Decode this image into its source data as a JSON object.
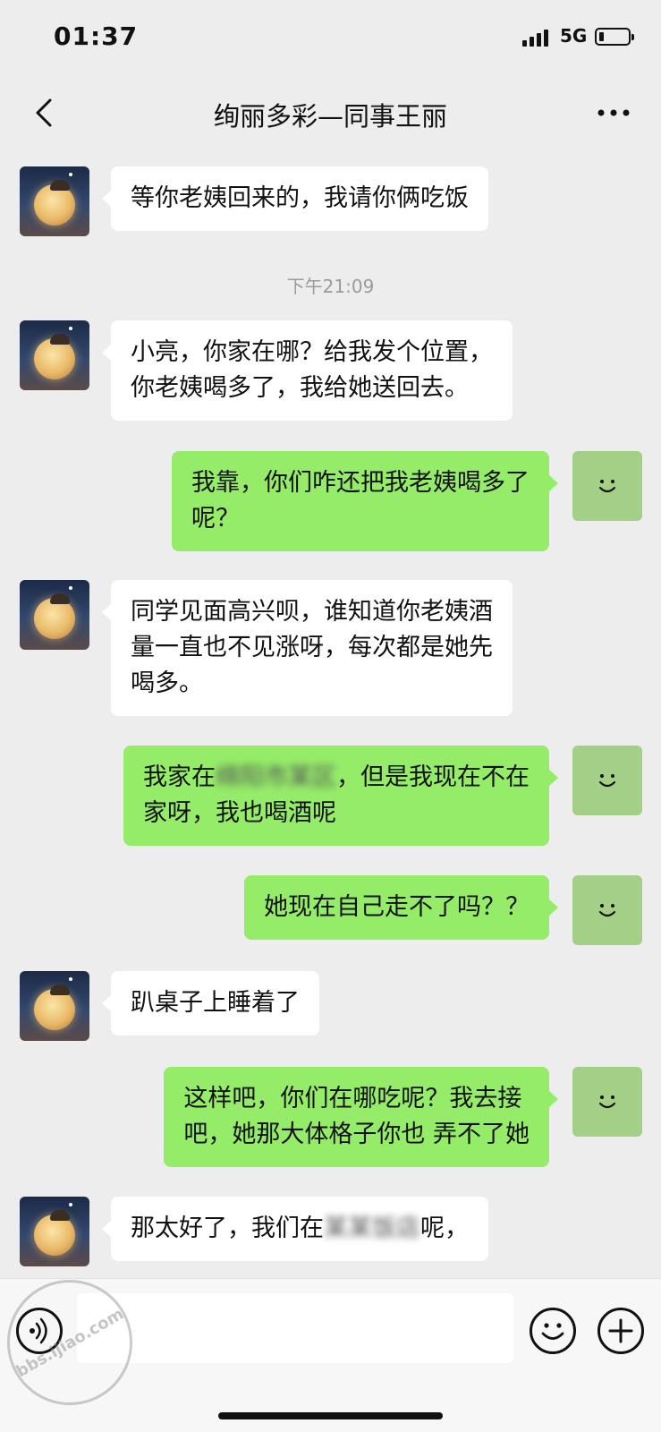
{
  "status_bar": {
    "time": "01:37",
    "network": "5G",
    "battery_level": 0.15
  },
  "header": {
    "back_icon": "chevron-left-icon",
    "title": "绚丽多彩—同事王丽",
    "more_icon": "more-dots-icon"
  },
  "timestamp": "下午21:09",
  "messages": [
    {
      "side": "in",
      "lines": [
        "等你老姨回来的，我请你俩吃饭"
      ]
    },
    {
      "side": "in",
      "lines": [
        "小亮，你家在哪？给我发个位置，",
        "你老姨喝多了，我给她送回去。"
      ]
    },
    {
      "side": "out",
      "lines": [
        "我靠，你们咋还把我老姨喝多了",
        "呢？"
      ]
    },
    {
      "side": "in",
      "lines": [
        "同学见面高兴呗，谁知道你老姨酒",
        "量一直也不见涨呀，每次都是她先",
        "喝多。"
      ]
    },
    {
      "side": "out",
      "line1_before": "我家在",
      "line1_redacted": "绵阳市某区",
      "line1_after": "，但是我现在不在",
      "line2": "家呀，我也喝酒呢"
    },
    {
      "side": "out",
      "lines": [
        "她现在自己走不了吗？？"
      ]
    },
    {
      "side": "in",
      "lines": [
        "趴桌子上睡着了"
      ]
    },
    {
      "side": "out",
      "lines": [
        "这样吧，你们在哪吃呢？我去接",
        "吧，她那大体格子你也 弄不了她"
      ]
    },
    {
      "side": "in",
      "line1_before": "那太好了，我们在",
      "line1_redacted": "某某饭店",
      "line1_after": "呢，"
    }
  ],
  "input_bar": {
    "voice_icon": "voice-icon",
    "input_value": "",
    "emoji_icon": "emoji-icon",
    "plus_icon": "plus-icon"
  },
  "watermark": {
    "text": "bbs.ijiao.com"
  },
  "colors": {
    "background": "#ededed",
    "bubble_in": "#ffffff",
    "bubble_out": "#95ec69",
    "timestamp_text": "#9b9b9b"
  }
}
